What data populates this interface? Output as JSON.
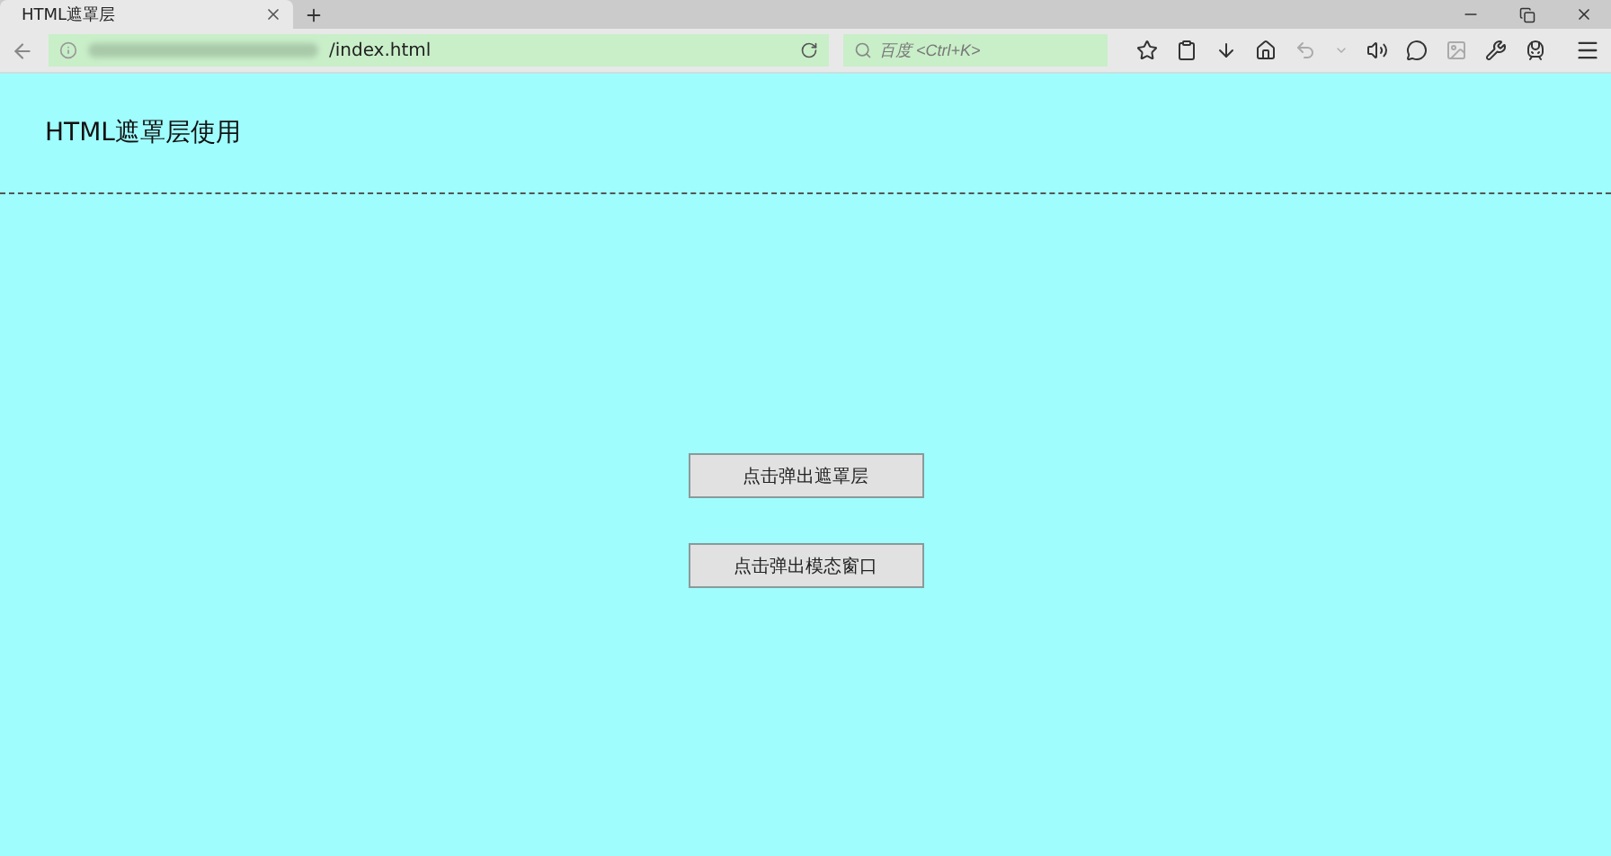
{
  "browser": {
    "tab": {
      "title": "HTML遮罩层",
      "selected": true
    },
    "address": "/index.html",
    "search": {
      "placeholder": "百度 <Ctrl+K>"
    }
  },
  "page": {
    "heading": "HTML遮罩层使用",
    "buttons": [
      "点击弹出遮罩层",
      "点击弹出模态窗口"
    ]
  }
}
